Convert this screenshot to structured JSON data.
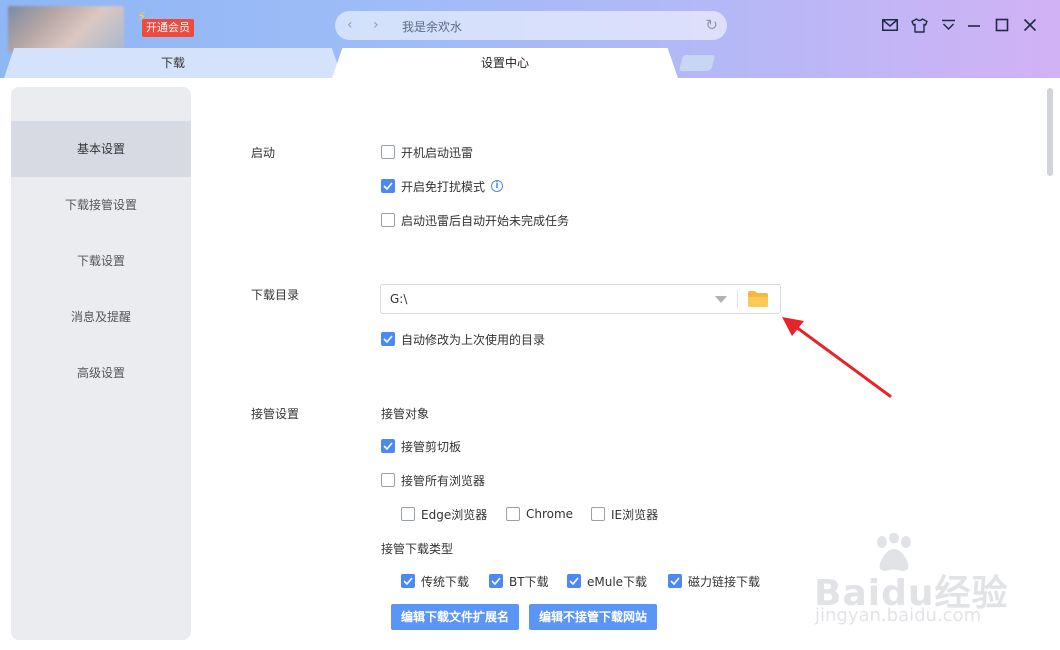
{
  "titlebar": {
    "vip_label": "开通会员",
    "address_text": "我是余欢水",
    "icons": [
      "mail-icon",
      "tshirt-icon",
      "menu-icon",
      "minimize-icon",
      "maximize-icon",
      "close-icon"
    ]
  },
  "tabs": [
    {
      "label": "下载",
      "active": false
    },
    {
      "label": "设置中心",
      "active": true
    }
  ],
  "sidebar": {
    "items": [
      {
        "label": "基本设置",
        "active": true
      },
      {
        "label": "下载接管设置",
        "active": false
      },
      {
        "label": "下载设置",
        "active": false
      },
      {
        "label": "消息及提醒",
        "active": false
      },
      {
        "label": "高级设置",
        "active": false
      }
    ]
  },
  "settings": {
    "startup": {
      "label": "启动",
      "options": [
        {
          "label": "开机启动迅雷",
          "checked": false
        },
        {
          "label": "开启免打扰模式",
          "checked": true
        },
        {
          "label": "启动迅雷后自动开始未完成任务",
          "checked": false
        }
      ]
    },
    "download_dir": {
      "label": "下载目录",
      "value": "G:\\",
      "auto_change": {
        "label": "自动修改为上次使用的目录",
        "checked": true
      }
    },
    "takeover": {
      "label": "接管设置",
      "objects_label": "接管对象",
      "clipboard": {
        "label": "接管剪切板",
        "checked": true
      },
      "all_browsers": {
        "label": "接管所有浏览器",
        "checked": false
      },
      "browsers": [
        {
          "label": "Edge浏览器",
          "checked": false
        },
        {
          "label": "Chrome",
          "checked": false
        },
        {
          "label": "IE浏览器",
          "checked": false
        }
      ],
      "types_label": "接管下载类型",
      "types": [
        {
          "label": "传统下载",
          "checked": true
        },
        {
          "label": "BT下载",
          "checked": true
        },
        {
          "label": "eMule下载",
          "checked": true
        },
        {
          "label": "磁力链接下载",
          "checked": true
        }
      ],
      "buttons": {
        "edit_ext": "编辑下载文件扩展名",
        "edit_sites": "编辑不接管下载网站"
      }
    }
  },
  "watermark": {
    "brand": "Baidu经验",
    "url": "jingyan.baidu.com"
  },
  "colors": {
    "accent": "#4c89f5",
    "annotation_arrow": "#e8242a"
  }
}
